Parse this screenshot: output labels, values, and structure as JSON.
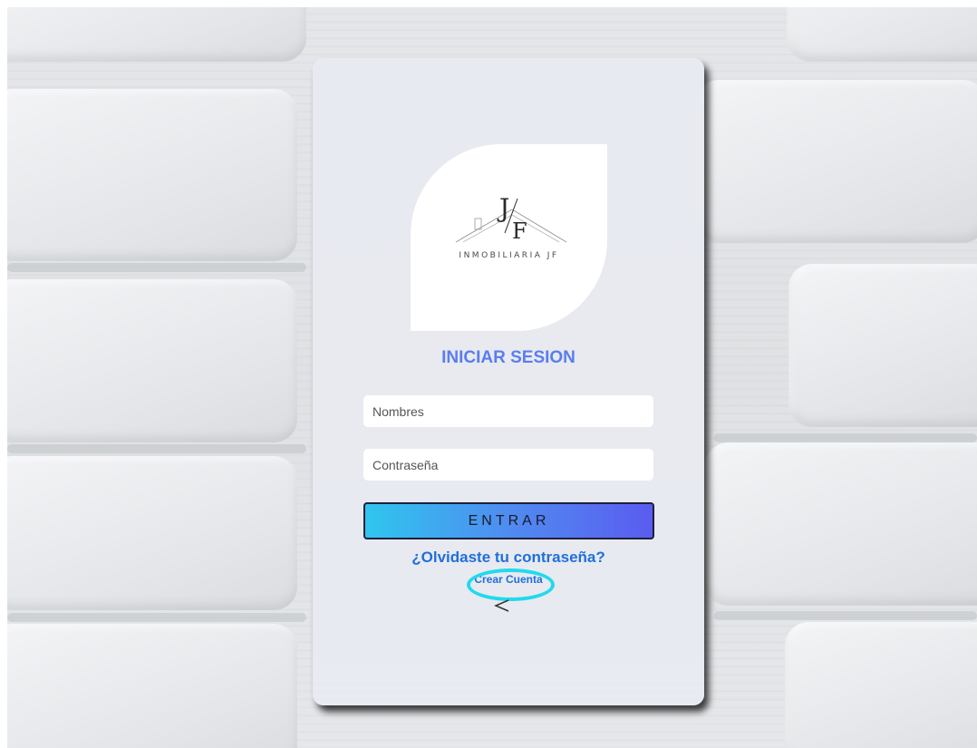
{
  "logo": {
    "monogram": "J/F",
    "brand_text": "INMOBILIARIA JF"
  },
  "login": {
    "title": "INICIAR SESION",
    "username_placeholder": "Nombres",
    "password_placeholder": "Contraseña",
    "submit_label": "ENTRAR",
    "forgot_link": "¿Olvidaste tu contraseña?",
    "create_account_link": "Crear Cuenta"
  },
  "colors": {
    "title": "#5b7df0",
    "link": "#1f6fdc",
    "button_gradient_start": "#2fc6ee",
    "button_gradient_end": "#5a5cf0",
    "highlight_ring": "#22d9ee"
  },
  "icons": {
    "back": "chevron-left-icon",
    "logo_roof": "house-roof-icon"
  }
}
